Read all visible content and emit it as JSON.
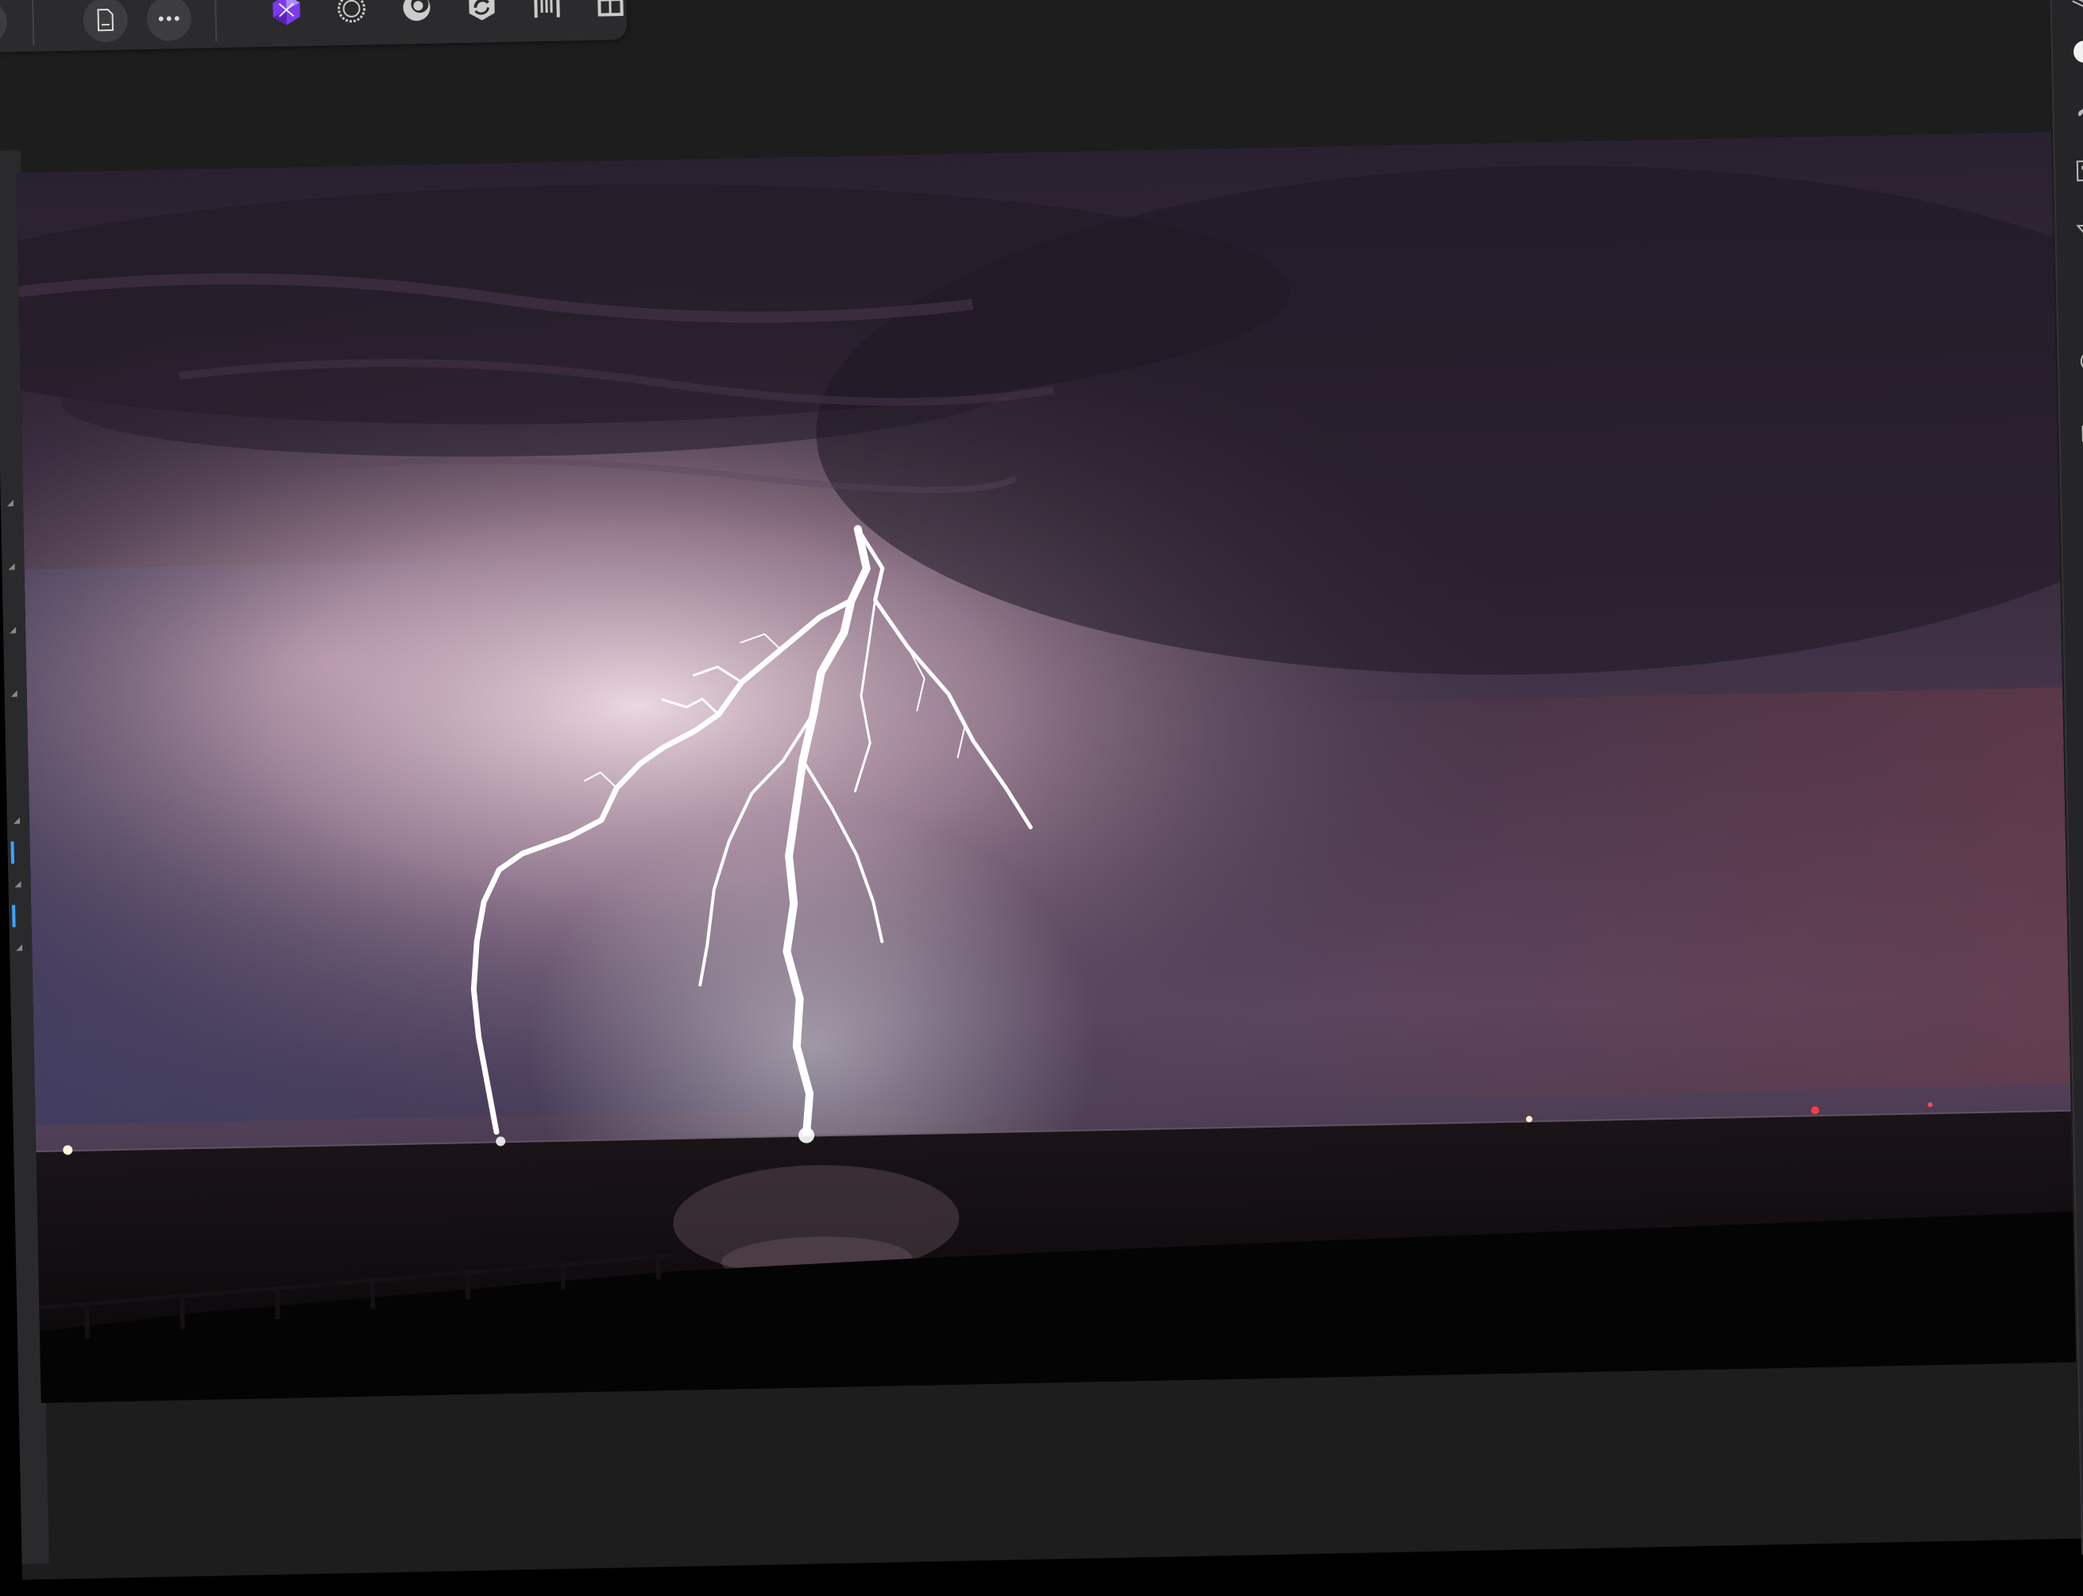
{
  "app": {
    "name": "Affinity Photo",
    "active_persona": "photo-persona"
  },
  "toolbar": {
    "buttons": [
      {
        "name": "document-button",
        "icon": "document-icon"
      },
      {
        "name": "more-button",
        "icon": "ellipsis-icon"
      }
    ],
    "personas": [
      {
        "name": "photo-persona",
        "icon": "affinity-photo-icon",
        "active": true
      },
      {
        "name": "liquify-persona",
        "icon": "liquify-icon"
      },
      {
        "name": "develop-persona",
        "icon": "develop-icon"
      },
      {
        "name": "tone-mapping-persona",
        "icon": "tone-mapping-icon"
      },
      {
        "name": "export-persona",
        "icon": "export-icon"
      },
      {
        "name": "layout-persona",
        "icon": "layout-icon"
      }
    ]
  },
  "studio_icons": [
    "layers-icon",
    "color-icon",
    "brush-icon",
    "adjustment-icon",
    "filter-icon",
    "fx-icon",
    "history-icon",
    "snapshot-icon",
    "channels-icon",
    "pages-icon"
  ],
  "colors": {
    "accent": "#8b5cf6",
    "ui_dark": "#1d1d1e",
    "toolbar": "#2b2b2d",
    "selection_blue": "#3aa3ff"
  },
  "canvas": {
    "subject": "lightning-over-sea-photo"
  }
}
